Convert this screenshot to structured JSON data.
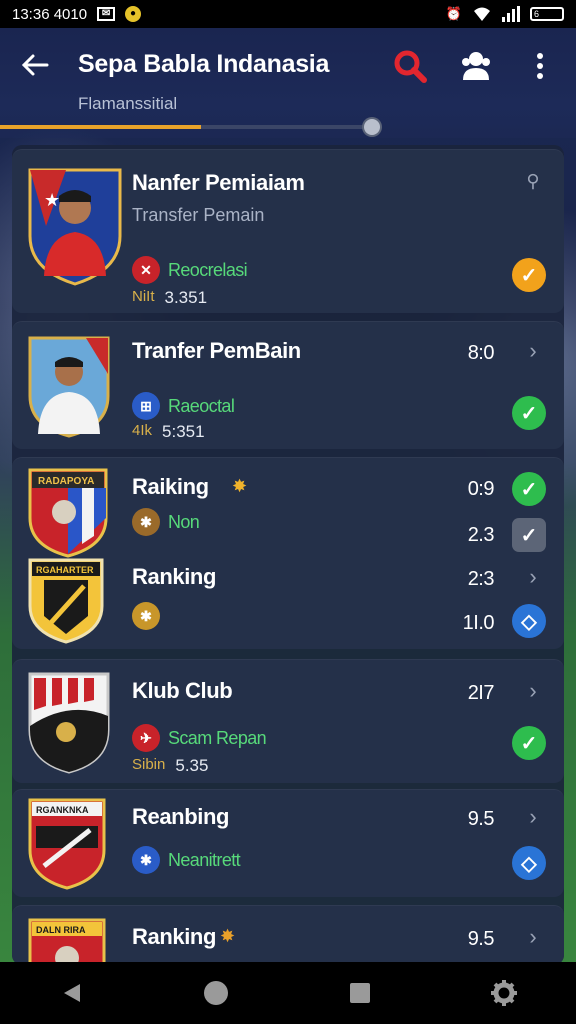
{
  "status": {
    "time": "13:36 4010",
    "left_icons": [
      "mail-icon",
      "notification-icon"
    ],
    "right_icons": [
      "alarm-icon",
      "wifi-icon",
      "signal-icon",
      "battery-icon"
    ],
    "battery_text": "6"
  },
  "header": {
    "title": "Sepa Babla Indanasia",
    "subtitle": "Flamanssitial"
  },
  "progress": {
    "value": 0.53
  },
  "cards": [
    {
      "name": "Nanfer Pemiaiam",
      "sub": "Transfer Pemain",
      "tag": "Reocrelasi",
      "stat_label": "NiIt",
      "stat_value": "3.351",
      "tag_color": "#c8232a",
      "action": "orange-check",
      "corner": "search"
    },
    {
      "name": "Tranfer PemBain",
      "score": "8:0",
      "tag": "Raeoctal",
      "stat_label": "4Ik",
      "stat_value": "5:351",
      "tag_color": "#2a5cc8",
      "action": "green-check"
    },
    {
      "name": "Raiking",
      "score": "0:9",
      "tag": "Non",
      "score2": "2.3",
      "tag_color": "#9a6a2a",
      "action": "green-check",
      "action2": "gray-check"
    },
    {
      "name": "Ranking",
      "score": "2:3",
      "score2": "1I.0",
      "tag_color": "#c8962a",
      "action": "chevron",
      "action2": "blue-diamond"
    },
    {
      "name": "Klub Club",
      "score": "2I7",
      "tag": "Scam Repan",
      "stat_label": "Sibin",
      "stat_value": "5.35",
      "tag_color": "#c8232a",
      "action": "chevron",
      "action2": "green-check"
    },
    {
      "name": "Reanbing",
      "score": "9.5",
      "tag": "Neanitrett",
      "tag_color": "#2a5cc8",
      "action": "chevron",
      "action2": "blue-diamond"
    },
    {
      "name": "Ranking",
      "score": "9.5",
      "action": "chevron"
    }
  ],
  "nav": [
    "back-icon",
    "home-icon",
    "recents-icon",
    "settings-icon"
  ]
}
